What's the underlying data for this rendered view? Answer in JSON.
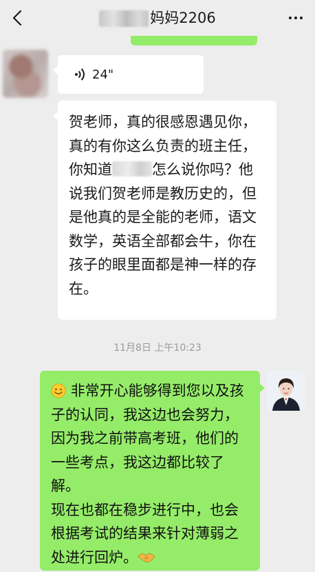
{
  "header": {
    "title": "妈妈2206",
    "back_icon": "chevron-left-icon",
    "more_icon": "more-dots-icon"
  },
  "voice_message": {
    "duration": "24\""
  },
  "incoming_message": {
    "part1": "贺老师，真的很感恩遇见你，真的有你这么负责的班主任，你知道",
    "part2": "怎么说你吗？他说我们贺老师是教历史的，但是他真的是全能的老师，语文数学，英语全部都会牛，你在孩子的眼里面都是神一样的存在。"
  },
  "timestamp": "11月8日 上午10:23",
  "outgoing_message": {
    "text": "非常开心能够得到您以及孩子的认同，我这边也会努力，因为我之前带高考班，他们的一些考点，我这边都比较了解。\n现在也都在稳步进行中，也会根据考试的结果来针对薄弱之处进行回炉。",
    "leading_emoji": "smile-emoji",
    "trailing_emoji": "handshake-emoji"
  },
  "colors": {
    "background": "#ededed",
    "outgoing_bubble": "#95ec69",
    "incoming_bubble": "#ffffff",
    "timestamp": "#9a9a9a"
  }
}
